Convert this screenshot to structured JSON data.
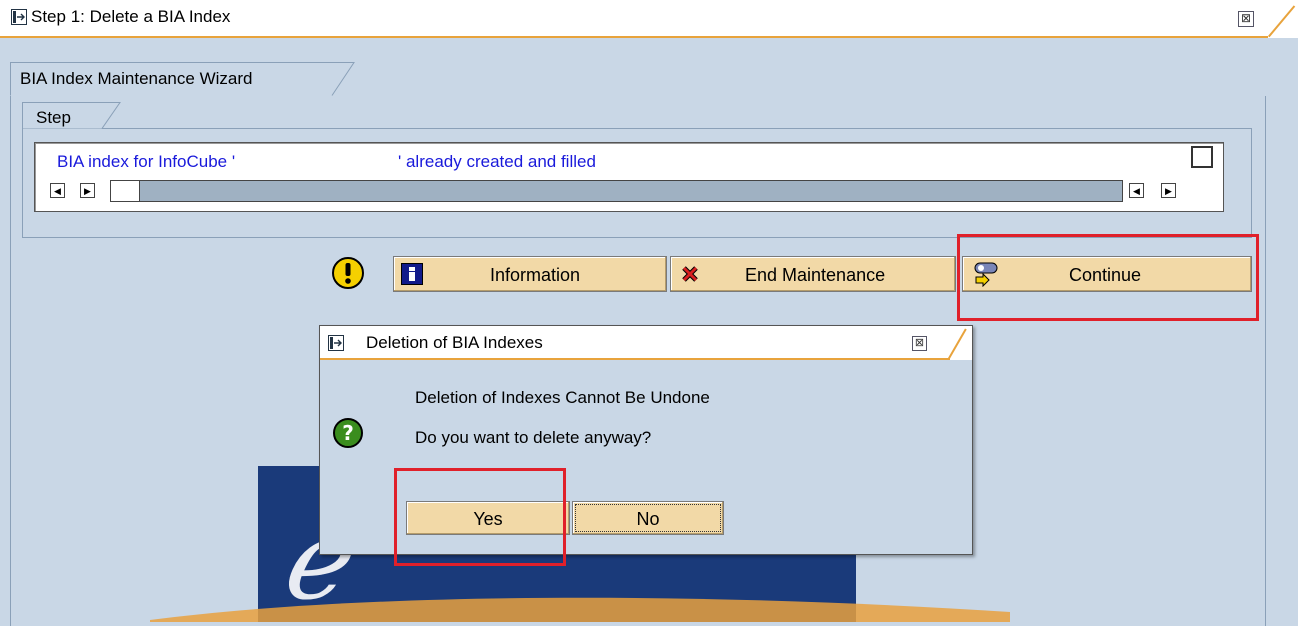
{
  "window": {
    "title": "Step 1: Delete a BIA Index",
    "close_glyph": "⊠",
    "accent_color": "#e8a33c"
  },
  "wizard": {
    "title": "BIA Index Maintenance Wizard",
    "step_group": {
      "label": "Step",
      "text_part_1": "BIA index for InfoCube '",
      "text_part_2": "' already created and filled",
      "text_color": "#1a1adb"
    }
  },
  "toolbar": {
    "information_label": "Information",
    "end_maintenance_label": "End Maintenance",
    "continue_label": "Continue",
    "button_color": "#f2d9a7"
  },
  "dialog": {
    "title": "Deletion of BIA Indexes",
    "message_line_1": "Deletion of Indexes Cannot Be Undone",
    "message_line_2": "Do you want to delete anyway?",
    "yes_label": "Yes",
    "no_label": "No"
  },
  "highlights": {
    "color": "#e0202a"
  }
}
